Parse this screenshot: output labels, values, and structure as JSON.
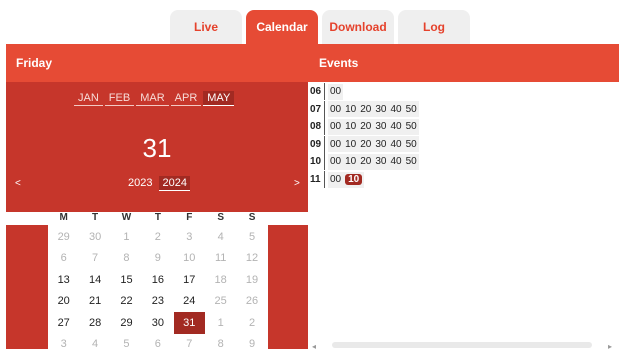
{
  "tabs": [
    {
      "label": "Live",
      "active": false
    },
    {
      "label": "Calendar",
      "active": true
    },
    {
      "label": "Download",
      "active": false
    },
    {
      "label": "Log",
      "active": false
    }
  ],
  "header": {
    "left_title": "Friday",
    "right_title": "Events"
  },
  "calendar": {
    "months": [
      "JAN",
      "FEB",
      "MAR",
      "APR",
      "MAY"
    ],
    "selected_month": "MAY",
    "selected_day": "31",
    "years": [
      "2023",
      "2024"
    ],
    "selected_year": "2024",
    "prev": "<",
    "next": ">",
    "weekdays": [
      "M",
      "T",
      "W",
      "T",
      "F",
      "S",
      "S"
    ],
    "weeks": [
      [
        [
          "29",
          "muted"
        ],
        [
          "30",
          "muted"
        ],
        [
          "1",
          "muted"
        ],
        [
          "2",
          "muted"
        ],
        [
          "3",
          "muted"
        ],
        [
          "4",
          "muted"
        ],
        [
          "5",
          "muted"
        ]
      ],
      [
        [
          "6",
          "muted"
        ],
        [
          "7",
          "muted"
        ],
        [
          "8",
          "muted"
        ],
        [
          "9",
          "muted"
        ],
        [
          "10",
          "muted"
        ],
        [
          "11",
          "muted"
        ],
        [
          "12",
          "muted"
        ]
      ],
      [
        [
          "13",
          ""
        ],
        [
          "14",
          ""
        ],
        [
          "15",
          ""
        ],
        [
          "16",
          ""
        ],
        [
          "17",
          ""
        ],
        [
          "18",
          "muted"
        ],
        [
          "19",
          "muted"
        ]
      ],
      [
        [
          "20",
          ""
        ],
        [
          "21",
          ""
        ],
        [
          "22",
          ""
        ],
        [
          "23",
          ""
        ],
        [
          "24",
          ""
        ],
        [
          "25",
          "muted"
        ],
        [
          "26",
          "muted"
        ]
      ],
      [
        [
          "27",
          ""
        ],
        [
          "28",
          ""
        ],
        [
          "29",
          ""
        ],
        [
          "30",
          ""
        ],
        [
          "31",
          "sel"
        ],
        [
          "1",
          "muted"
        ],
        [
          "2",
          "muted"
        ]
      ],
      [
        [
          "3",
          "muted"
        ],
        [
          "4",
          "muted"
        ],
        [
          "5",
          "muted"
        ],
        [
          "6",
          "muted"
        ],
        [
          "7",
          "muted"
        ],
        [
          "8",
          "muted"
        ],
        [
          "9",
          "muted"
        ]
      ]
    ]
  },
  "events": [
    {
      "hour": "06",
      "minutes": [
        "00"
      ],
      "selected": ""
    },
    {
      "hour": "07",
      "minutes": [
        "00",
        "10",
        "20",
        "30",
        "40",
        "50"
      ],
      "selected": ""
    },
    {
      "hour": "08",
      "minutes": [
        "00",
        "10",
        "20",
        "30",
        "40",
        "50"
      ],
      "selected": ""
    },
    {
      "hour": "09",
      "minutes": [
        "00",
        "10",
        "20",
        "30",
        "40",
        "50"
      ],
      "selected": ""
    },
    {
      "hour": "10",
      "minutes": [
        "00",
        "10",
        "20",
        "30",
        "40",
        "50"
      ],
      "selected": ""
    },
    {
      "hour": "11",
      "minutes": [
        "00",
        "10"
      ],
      "selected": "10"
    }
  ],
  "colors": {
    "accent": "#e64b35",
    "dark": "#c6362b",
    "selected": "#a22a22"
  }
}
